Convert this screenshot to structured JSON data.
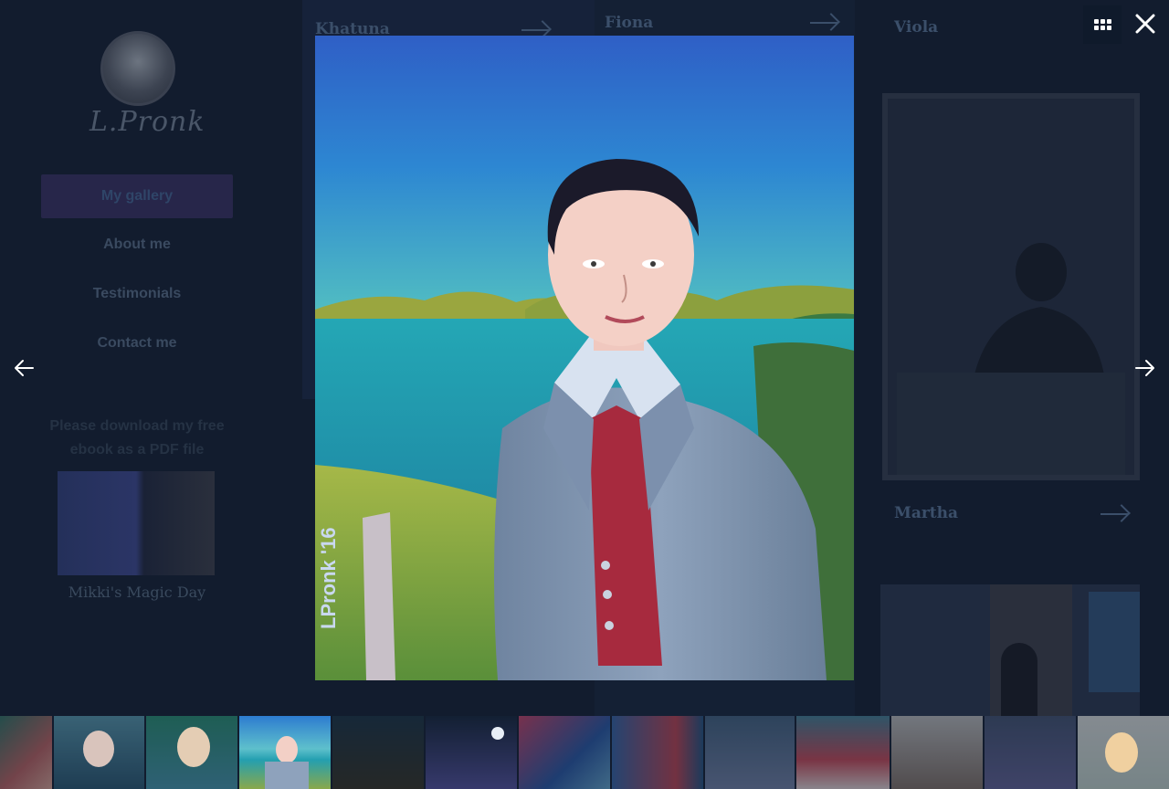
{
  "site": {
    "logo_text": "L.Pronk",
    "nav": [
      {
        "label": "My gallery",
        "active": true
      },
      {
        "label": "About me",
        "active": false
      },
      {
        "label": "Testimonials",
        "active": false
      },
      {
        "label": "Contact me",
        "active": false
      }
    ],
    "ebook_prompt": "Please download my free ebook as a PDF file",
    "ebook_title": "Mikki's Magic Day"
  },
  "gallery_cards": [
    {
      "title": "Khatuna"
    },
    {
      "title": "Fiona"
    },
    {
      "title": "Viola"
    },
    {
      "title": "Martha"
    }
  ],
  "lightbox": {
    "painting_signature": "LPronk '16",
    "controls": {
      "grid": "grid-icon",
      "close": "close-icon",
      "prev": "arrow-left-icon",
      "next": "arrow-right-icon"
    },
    "thumbnail_count": 13,
    "active_thumbnail_index": 3
  },
  "colors": {
    "overlay": "#0c1624",
    "accent": "#27264a",
    "text_on_dark": "#ffffff"
  }
}
